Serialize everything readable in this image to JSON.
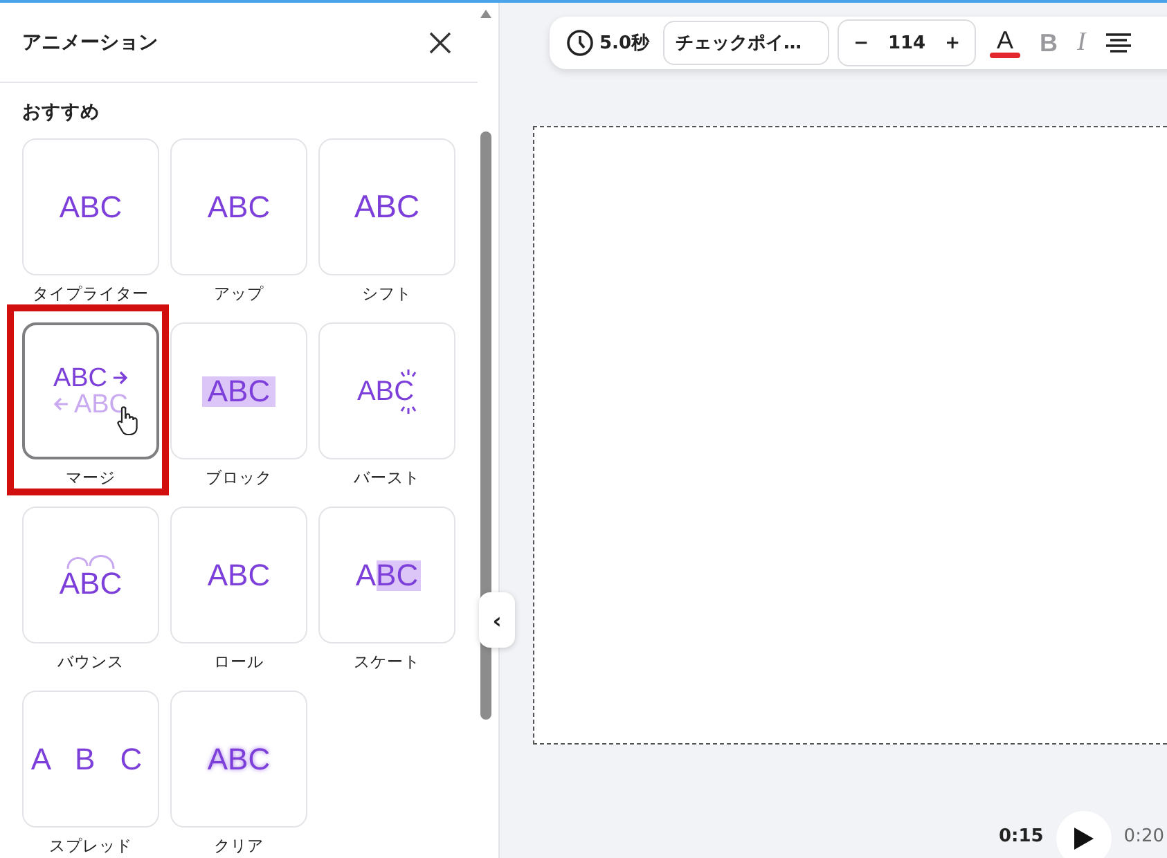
{
  "panel": {
    "title": "アニメーション",
    "section": "おすすめ",
    "animations": [
      {
        "kind": "typewriter",
        "label": "タイプライター",
        "previews": [
          "ABC"
        ],
        "selected": false
      },
      {
        "kind": "up",
        "label": "アップ",
        "previews": [
          "ABC"
        ],
        "selected": false
      },
      {
        "kind": "shift",
        "label": "シフト",
        "previews": [
          "ABC"
        ],
        "selected": false
      },
      {
        "kind": "merge",
        "label": "マージ",
        "previews": [
          "ABC",
          "ABC"
        ],
        "selected": true
      },
      {
        "kind": "block",
        "label": "ブロック",
        "previews": [
          "ABC"
        ],
        "selected": false
      },
      {
        "kind": "burst",
        "label": "バースト",
        "previews": [
          "ABC"
        ],
        "selected": false
      },
      {
        "kind": "bounce",
        "label": "バウンス",
        "previews": [
          "ABC"
        ],
        "selected": false
      },
      {
        "kind": "roll",
        "label": "ロール",
        "previews": [
          "ABC"
        ],
        "selected": false
      },
      {
        "kind": "skate",
        "label": "スケート",
        "previews": [
          "ABC"
        ],
        "selected": false
      },
      {
        "kind": "spread",
        "label": "スプレッド",
        "previews": [
          "A B C"
        ],
        "selected": false
      },
      {
        "kind": "clear",
        "label": "クリア",
        "previews": [
          "ABC"
        ],
        "selected": false
      }
    ]
  },
  "toolbar": {
    "duration": "5.0秒",
    "font": "チェックポイ…",
    "size_minus": "−",
    "size": "114",
    "size_plus": "+",
    "text_color": {
      "glyph": "A",
      "color": "#e4262f"
    },
    "bold": "B",
    "italic": "I"
  },
  "collapse_glyph": "‹",
  "playback": {
    "current": "0:15",
    "total": "0:20"
  }
}
